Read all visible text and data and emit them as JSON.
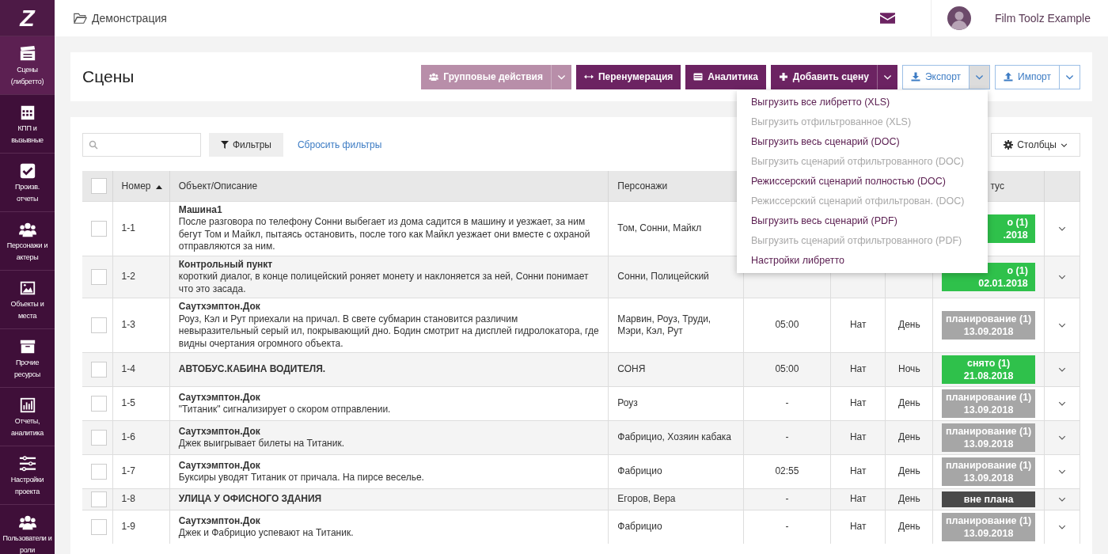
{
  "logo_text": "Z",
  "sidebar": {
    "items": [
      {
        "lines": [
          "Сцены",
          "(либретто)"
        ],
        "selected": true
      },
      {
        "lines": [
          "КПП и",
          "вызывные"
        ],
        "selected": false
      },
      {
        "lines": [
          "Произв.",
          "отчеты"
        ],
        "selected": false
      },
      {
        "lines": [
          "Персонажи и",
          "актеры"
        ],
        "selected": false
      },
      {
        "lines": [
          "Объекты и",
          "места"
        ],
        "selected": false
      },
      {
        "lines": [
          "Прочие",
          "ресурсы"
        ],
        "selected": false
      },
      {
        "lines": [
          "Отчеты,",
          "аналитика"
        ],
        "selected": false
      },
      {
        "lines": [
          "Настройки",
          "проекта"
        ],
        "selected": false
      },
      {
        "lines": [
          "Пользователи и",
          "роли"
        ],
        "selected": false
      }
    ]
  },
  "breadcrumb": "Демонстрация",
  "user_name": "Film Toolz Example",
  "page_title": "Сцены",
  "toolbar": [
    {
      "label": "Групповые действия",
      "kind": "split",
      "disabled": true,
      "expanded": false
    },
    {
      "label": "Перенумерация",
      "kind": "plain",
      "disabled": false
    },
    {
      "label": "Аналитика",
      "kind": "plain",
      "disabled": false
    },
    {
      "label": "Добавить сцену",
      "kind": "split",
      "disabled": false,
      "expanded": false
    },
    {
      "label": "Экспорт",
      "kind": "outline",
      "disabled": false,
      "expanded": true
    },
    {
      "label": "Импорт",
      "kind": "outline",
      "disabled": false,
      "expanded": false
    }
  ],
  "export_menu": [
    {
      "label": "Выгрузить все либретто (XLS)",
      "disabled": false
    },
    {
      "label": "Выгрузить отфильтрованное (XLS)",
      "disabled": true
    },
    {
      "label": "Выгрузить весь сценарий (DOC)",
      "disabled": false
    },
    {
      "label": "Выгрузить сценарий отфильтрованного (DOC)",
      "disabled": true
    },
    {
      "label": "Режиссерский сценарий полностью (DOC)",
      "disabled": false
    },
    {
      "label": "Режиссерский сценарий отфильтрован. (DOC)",
      "disabled": true
    },
    {
      "label": "Выгрузить весь сценарий (PDF)",
      "disabled": false
    },
    {
      "label": "Выгрузить сценарий отфильтрованного (PDF)",
      "disabled": true
    },
    {
      "label": "Настройки либретто",
      "disabled": false
    }
  ],
  "filters": {
    "button": "Фильтры",
    "reset": "Сбросить фильтры",
    "columns_button": "Столбцы"
  },
  "table": {
    "select_all_checked": false,
    "columns": {
      "number": "Номер",
      "number_sorted": true,
      "object": "Объект/Описание",
      "characters": "Персонажи",
      "status": "тус"
    },
    "rows": [
      {
        "checked": false,
        "number": "1-1",
        "title": "Машина1",
        "description": "После разговора по телефону Сонни выбегает из дома садится в машину и уезжает, за ним бегут Том и Майкл, пытаясь остановить, после того как Майкл уезжает они вместе с охраной отправляются за ним.",
        "characters": "Том, Сонни, Майкл",
        "status": {
          "color": "#2fc14b",
          "lines": [
            "о (1)",
            ".2018"
          ],
          "clipped": true
        }
      },
      {
        "checked": false,
        "number": "1-2",
        "title": "Контрольный пункт",
        "description": "короткий диалог, в конце полицейский роняет монету и наклоняется за ней, Сонни понимает что это засада.",
        "characters": "Сонни, Полицейский",
        "status": {
          "color": "#2fc14b",
          "lines": [
            "о (1)",
            "02.01.2018"
          ],
          "clipped": true
        }
      },
      {
        "checked": false,
        "number": "1-3",
        "title": "Саутхэмптон.Док",
        "description": "Роуз, Кэл и Рут приехали на причал. В свете субмарин становится различим невыразительный серый ил, покрывающий дно. Бодин смотрит на дисплей гидролокатора, где видны очертания огромного объекта.",
        "characters": "Марвин, Роуз, Труди, Мэри, Кэл, Рут",
        "time": "05:00",
        "int_ext": "Нат",
        "day": "День",
        "status": {
          "color": "#a6a6a6",
          "lines": [
            "планирование (1)",
            "13.09.2018"
          ],
          "clipped": false
        }
      },
      {
        "checked": false,
        "number": "1-4",
        "title": "АВТОБУС.КАБИНА ВОДИТЕЛЯ.",
        "characters": "СОНЯ",
        "time": "05:00",
        "int_ext": "Нат",
        "day": "Ночь",
        "status": {
          "color": "#2fc14b",
          "lines": [
            "снято (1)",
            "21.08.2018"
          ],
          "clipped": false
        }
      },
      {
        "checked": false,
        "number": "1-5",
        "title": "Саутхэмптон.Док",
        "description": "\"Титаник\" сигнализирует о скором отправлении.",
        "characters": "Роуз",
        "time": "-",
        "int_ext": "Нат",
        "day": "День",
        "status": {
          "color": "#a6a6a6",
          "lines": [
            "планирование (1)",
            "13.09.2018"
          ],
          "clipped": false
        }
      },
      {
        "checked": false,
        "number": "1-6",
        "title": "Саутхэмптон.Док",
        "description": "Джек выигрывает билеты на Титаник.",
        "characters": "Фабрицио, Хозяин кабака",
        "time": "-",
        "int_ext": "Нат",
        "day": "День",
        "status": {
          "color": "#a6a6a6",
          "lines": [
            "планирование (1)",
            "13.09.2018"
          ],
          "clipped": false
        }
      },
      {
        "checked": false,
        "number": "1-7",
        "title": "Саутхэмптон.Док",
        "description": "Буксиры уводят Титаник от причала. На пирсе веселье.",
        "characters": "Фабрицио",
        "time": "02:55",
        "int_ext": "Нат",
        "day": "День",
        "status": {
          "color": "#a6a6a6",
          "lines": [
            "планирование (1)",
            "13.09.2018"
          ],
          "clipped": false
        }
      },
      {
        "checked": false,
        "number": "1-8",
        "title": "УЛИЦА У ОФИСНОГО ЗДАНИЯ",
        "characters": "Егоров, Вера",
        "time": "-",
        "int_ext": "Нат",
        "day": "День",
        "status": {
          "color": "#4a4a4a",
          "lines": [
            "вне плана"
          ],
          "clipped": false
        }
      },
      {
        "checked": false,
        "number": "1-9",
        "title": "Саутхэмптон.Док",
        "description": "Джек и Фабрицио успевают на Титаник.",
        "characters": "Фабрицио",
        "time": "-",
        "int_ext": "Нат",
        "day": "День",
        "status": {
          "color": "#a6a6a6",
          "lines": [
            "планирование (1)",
            "13.09.2018"
          ],
          "clipped": false
        }
      }
    ]
  }
}
